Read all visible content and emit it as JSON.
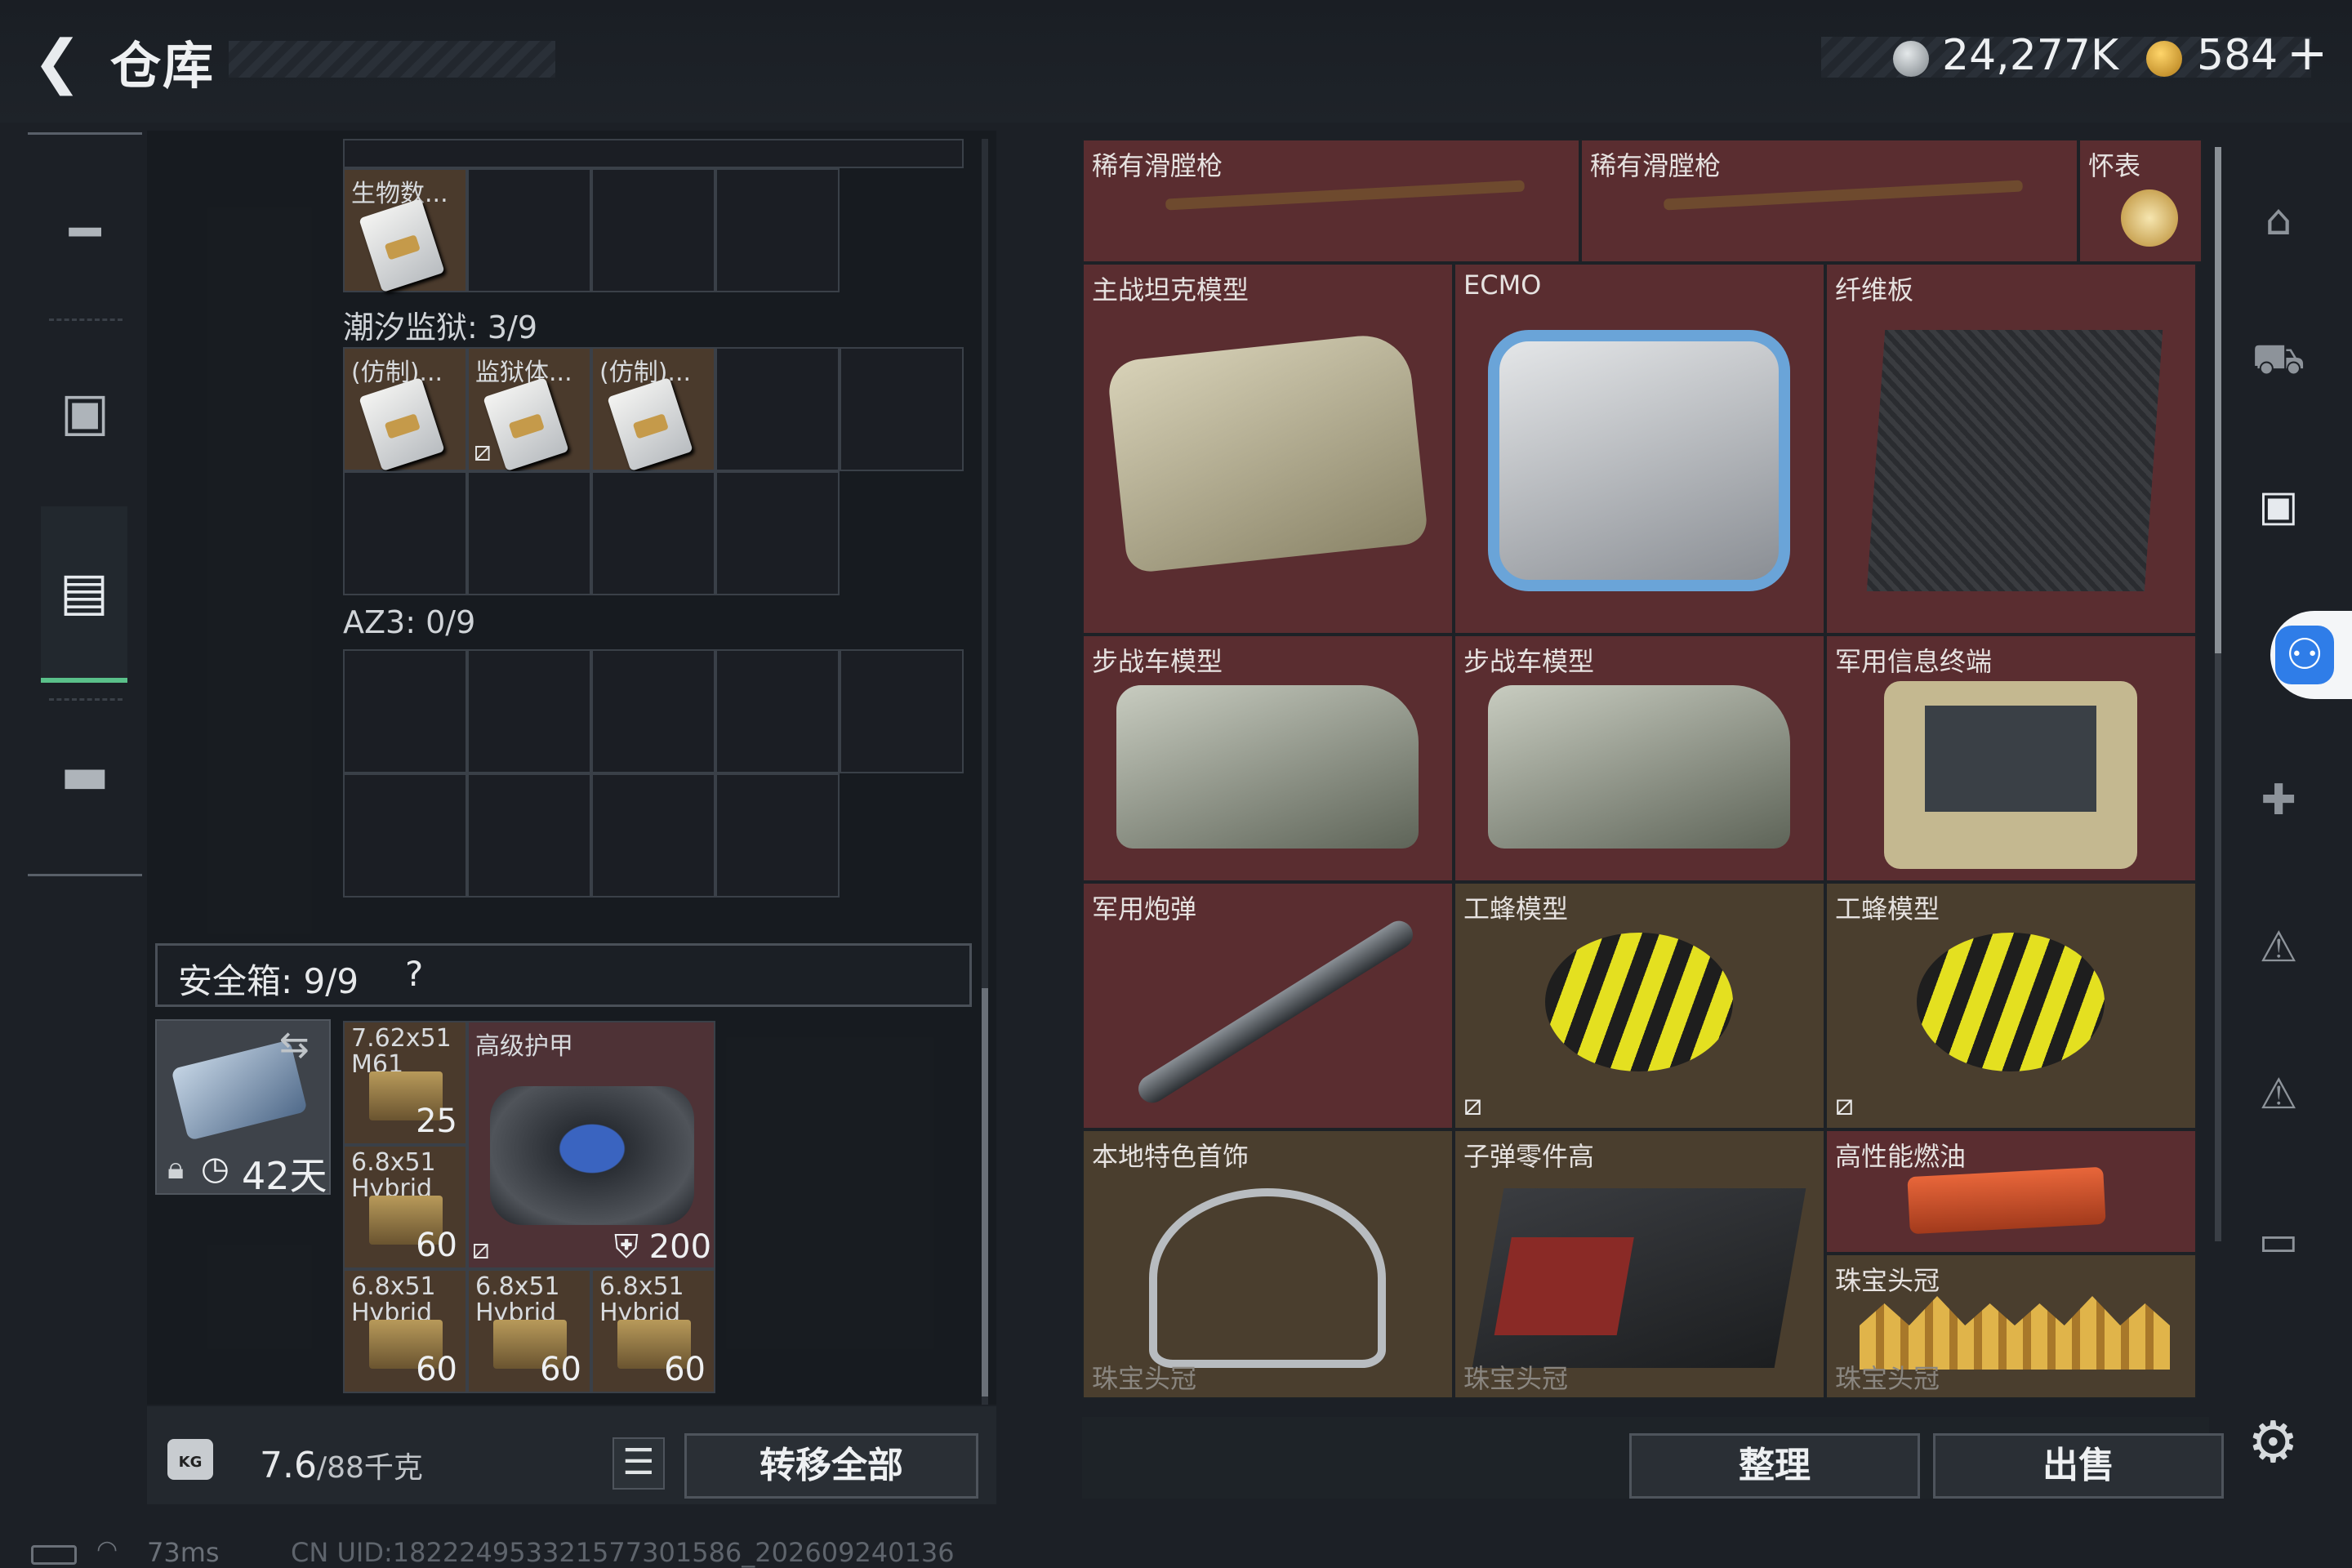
{
  "header": {
    "back_icon": "chevron-left-icon",
    "title": "仓库",
    "silver_amount": "24,277K",
    "gold_amount": "584",
    "gold_plus": "+"
  },
  "nav": {
    "items": [
      {
        "name": "weapons",
        "icon": "gun-icon"
      },
      {
        "name": "backpack",
        "icon": "backpack-icon"
      },
      {
        "name": "rig",
        "icon": "vest-icon",
        "active": true
      },
      {
        "name": "case",
        "icon": "briefcase-icon"
      }
    ]
  },
  "left": {
    "top_item": {
      "name": "生物数..."
    },
    "tide_prison": {
      "label": "潮汐监狱: 3/9",
      "items": [
        "(仿制)...",
        "监狱体...",
        "(仿制)..."
      ]
    },
    "az3": {
      "label": "AZ3: 0/9"
    },
    "safe": {
      "label": "安全箱: 9/9",
      "help": "?",
      "days": "42天",
      "ammo": [
        {
          "name": "7.62x51\nM61",
          "count": "25"
        },
        {
          "name": "6.8x51\nHybrid",
          "count": "60"
        },
        {
          "name": "6.8x51\nHybrid",
          "count": "60"
        },
        {
          "name": "6.8x51\nHybrid",
          "count": "60"
        },
        {
          "name": "6.8x51\nHybrid",
          "count": "60"
        }
      ],
      "armor": {
        "name": "高级护甲",
        "durability": "200"
      }
    },
    "weight": "7.6",
    "weight_cap": "/88千克",
    "kg_label": "KG",
    "transfer_all": "转移全部"
  },
  "status": {
    "ping": "73ms",
    "uid": "CN UID:182224953321577301586_202609240136"
  },
  "right": {
    "row1": [
      "稀有滑膛枪",
      "稀有滑膛枪",
      "怀表"
    ],
    "row2": [
      "主战坦克模型",
      "ECMO",
      "纤维板"
    ],
    "row3": [
      "步战车模型",
      "步战车模型",
      "军用信息终端"
    ],
    "row4": [
      "军用炮弹",
      "工蜂模型",
      "工蜂模型"
    ],
    "row5": [
      "本地特色首饰",
      "子弹零件高",
      "高性能燃油"
    ],
    "crown": "珠宝头冠",
    "row6": [
      "珠宝头冠",
      "珠宝头冠",
      "珠宝头冠"
    ],
    "sort_label": "整理",
    "sell_label": "出售"
  },
  "colors": {
    "item_red": "#5a2d30",
    "item_gold": "#4a3e2e",
    "active_green": "#5ac08a",
    "accessibility_blue": "#2f7de8"
  }
}
